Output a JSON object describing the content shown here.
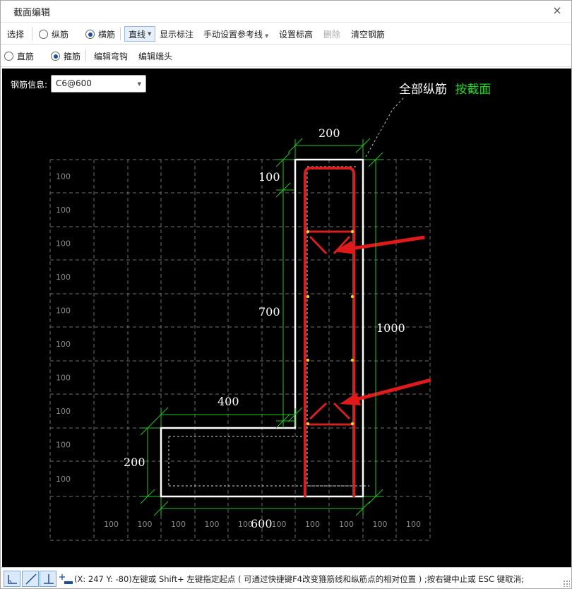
{
  "window": {
    "title": "截面编辑",
    "close_glyph": "×"
  },
  "toolbar1": {
    "select_label": "选择",
    "longitudinal_label": "纵筋",
    "transverse_label": "横筋",
    "line_mode_label": "直线",
    "show_dims_label": "显示标注",
    "manual_ref_label": "手动设置参考线",
    "set_elevation_label": "设置标高",
    "delete_label": "删除",
    "clear_rebar_label": "清空钢筋"
  },
  "toolbar2": {
    "straight_label": "直筋",
    "stirrup_label": "箍筋",
    "edit_hook_label": "编辑弯钩",
    "edit_end_label": "编辑端头"
  },
  "canvas": {
    "rebar_info_label": "钢筋信息:",
    "rebar_info_value": "C6@600",
    "annotation_white": "全部纵筋",
    "annotation_green": "按截面",
    "grid_label": "100",
    "dims": {
      "top_width": "200",
      "top_cover": "100",
      "web_height": "700",
      "total_height": "1000",
      "flange_length": "400",
      "flange_height": "200",
      "bottom_width": "600"
    },
    "colors": {
      "grid": "#6e6e6e",
      "section": "#ffffff",
      "dimension": "#22c422",
      "rebar": "#d42020",
      "arrow": "#e01a1a",
      "annotation_green": "#21d421"
    }
  },
  "statusbar": {
    "text": "(X: 247 Y: -80)左键或 Shift+ 左键指定起点 ( 可通过快捷键F4改变箍筋线和纵筋点的相对位置 ) ;按右键中止或 ESC 键取消;"
  }
}
